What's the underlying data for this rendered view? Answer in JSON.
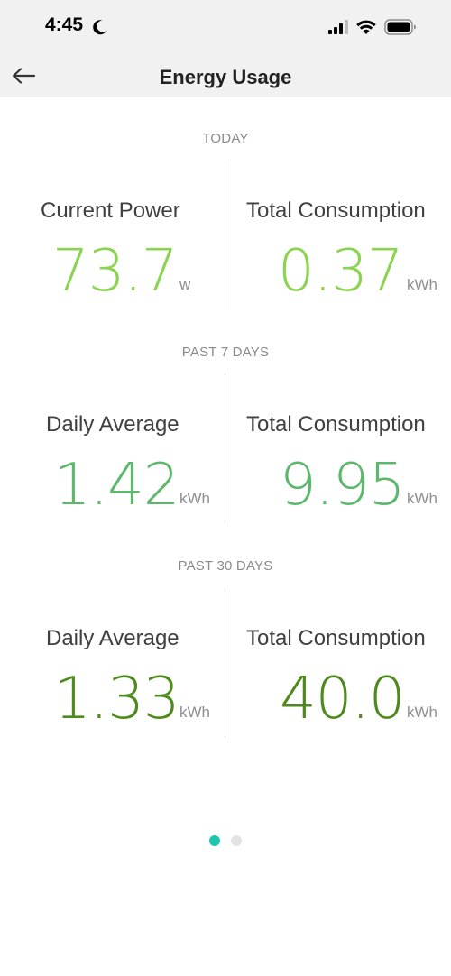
{
  "status_bar": {
    "time": "4:45",
    "icons": [
      "moon-icon",
      "signal-icon",
      "wifi-icon",
      "battery-icon"
    ]
  },
  "header": {
    "title": "Energy Usage",
    "back_icon": "arrow-left-icon"
  },
  "colors": {
    "today": "#8cd352",
    "past7": "#5db86e",
    "past30": "#4e8a1c",
    "pager_active": "#1fc4b0",
    "pager_inactive": "#e3e3e3"
  },
  "sections": [
    {
      "label": "TODAY",
      "left": {
        "title": "Current Power",
        "value": "73.7",
        "unit": "w"
      },
      "right": {
        "title": "Total Consumption",
        "value": "0.37",
        "unit": "kWh"
      }
    },
    {
      "label": "PAST 7 DAYS",
      "left": {
        "title": "Daily Average",
        "value": "1.42",
        "unit": "kWh"
      },
      "right": {
        "title": "Total Consumption",
        "value": "9.95",
        "unit": "kWh"
      }
    },
    {
      "label": "PAST 30 DAYS",
      "left": {
        "title": "Daily Average",
        "value": "1.33",
        "unit": "kWh"
      },
      "right": {
        "title": "Total Consumption",
        "value": "40.0",
        "unit": "kWh"
      }
    }
  ],
  "pager": {
    "page": 1,
    "total": 2
  }
}
